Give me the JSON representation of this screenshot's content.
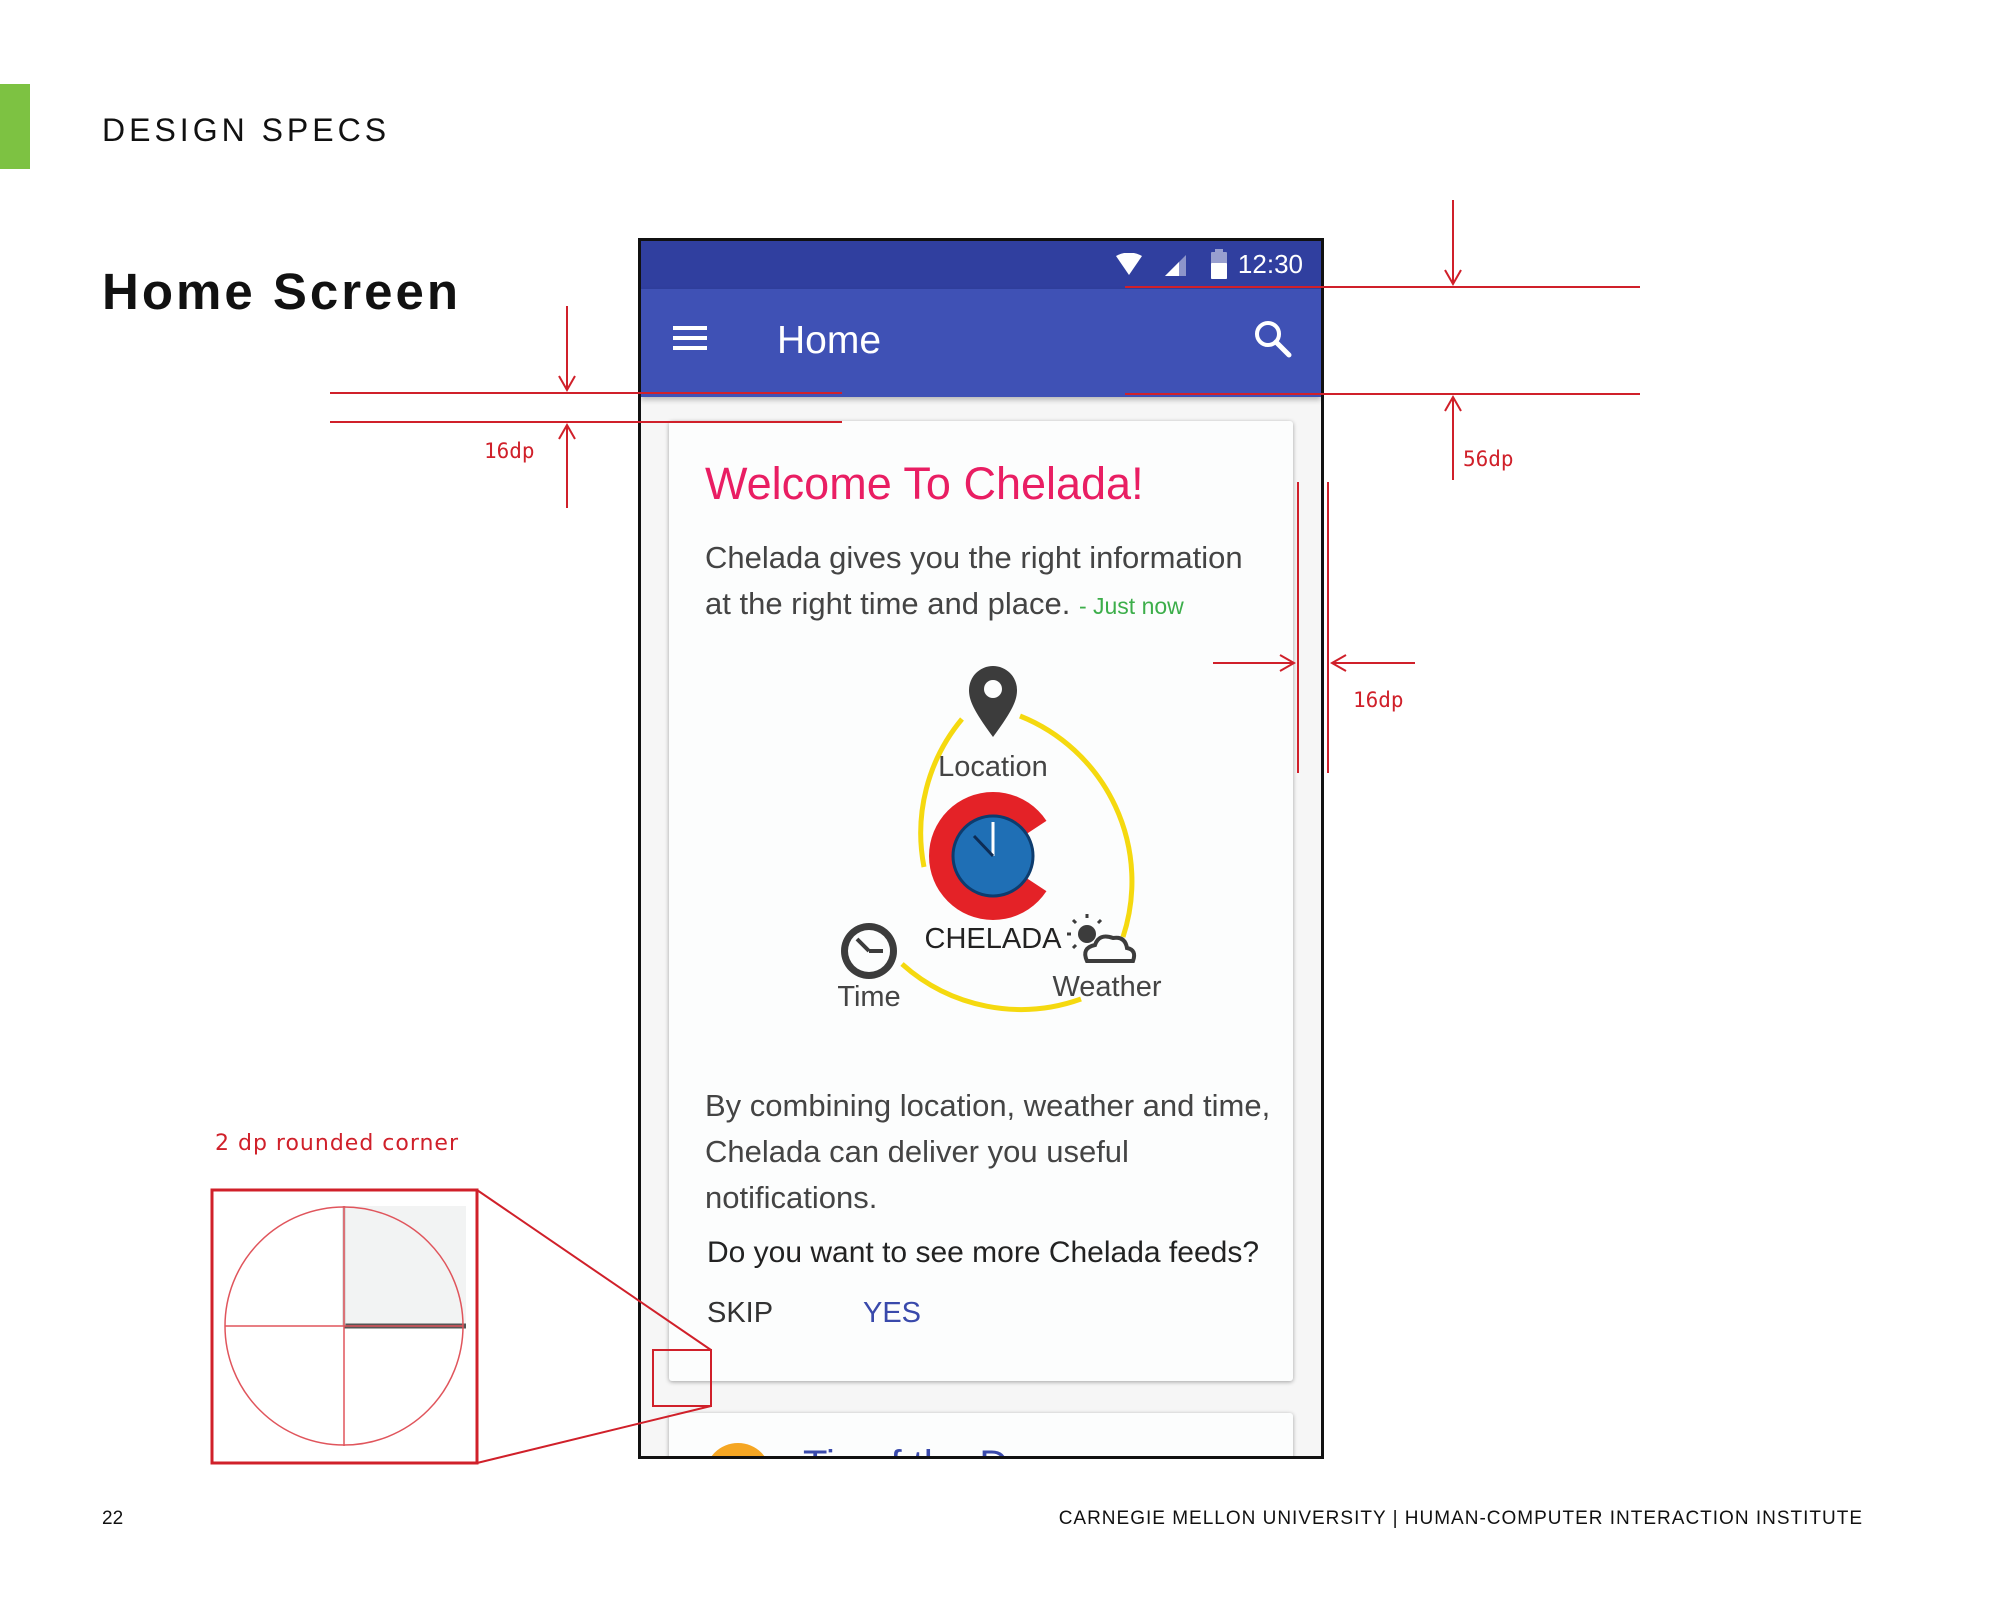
{
  "page": {
    "section_label": "DESIGN SPECS",
    "title": "Home Screen",
    "page_number": "22",
    "footer": "CARNEGIE MELLON UNIVERSITY | HUMAN-COMPUTER INTERACTION INSTITUTE",
    "accent_color": "#7dc242"
  },
  "phone": {
    "status_bar": {
      "time": "12:30",
      "icons": [
        "wifi-icon",
        "signal-icon",
        "battery-icon"
      ]
    },
    "app_bar": {
      "title": "Home",
      "menu_icon": "menu-icon",
      "search_icon": "search-icon"
    },
    "card": {
      "title": "Welcome To Chelada!",
      "body1": "Chelada gives you the right information at the right time and place.",
      "timestamp": "- Just now",
      "diagram": {
        "logo_text": "CHELADA",
        "location_label": "Location",
        "time_label": "Time",
        "weather_label": "Weather"
      },
      "body2": "By combining location, weather and time, Chelada can deliver you useful notifications.",
      "question": "Do you want to see more Chelada feeds?",
      "skip_label": "SKIP",
      "yes_label": "YES"
    },
    "card2": {
      "title": "Tip of the Day"
    },
    "colors": {
      "status_bar": "#303f9f",
      "app_bar": "#3f51b5",
      "card_title": "#e91e63",
      "timestamp": "#3cae4a",
      "ring": "#f5d90f",
      "logo_red": "#e42227",
      "logo_blue": "#1f6fb5",
      "yes_button": "#3949ab"
    }
  },
  "annotations": {
    "top_margin": "16dp",
    "app_bar_height": "56dp",
    "right_margin": "16dp",
    "rounded_corner": "2 dp rounded corner",
    "color": "#d0202a"
  }
}
